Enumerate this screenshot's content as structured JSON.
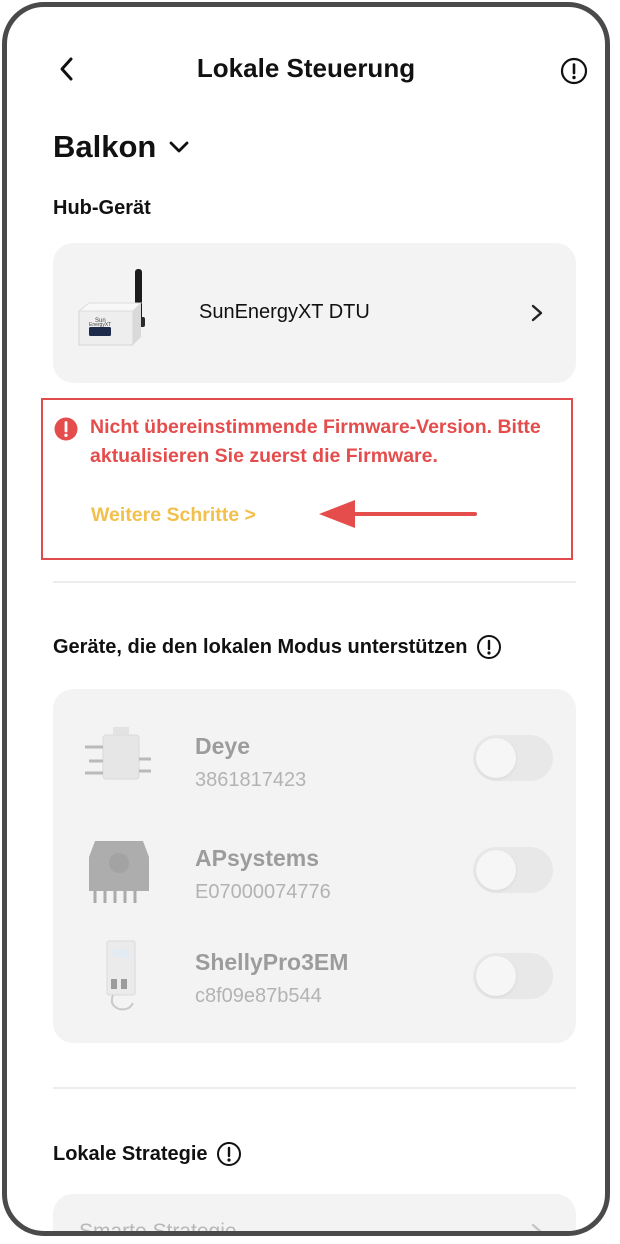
{
  "header": {
    "title": "Lokale Steuerung",
    "back_icon": "chevron-left-icon",
    "info_icon": "info-circle-icon"
  },
  "location": {
    "name": "Balkon",
    "dropdown_icon": "chevron-down-icon"
  },
  "hub": {
    "section_label": "Hub-Gerät",
    "device_name": "SunEnergyXT DTU",
    "image_text": "SunEnergyXT"
  },
  "warning": {
    "message": "Nicht übereinstimmende Firmware-Version. Bitte aktualisieren Sie zuerst die Firmware.",
    "link_label": "Weitere Schritte >",
    "color": "#e54d4d",
    "link_color": "#f2c04c"
  },
  "devices": {
    "section_label": "Geräte, die den lokalen Modus unterstützen",
    "items": [
      {
        "name": "Deye",
        "serial": "3861817423",
        "enabled": false
      },
      {
        "name": "APsystems",
        "serial": "E07000074776",
        "enabled": false
      },
      {
        "name": "ShellyPro3EM",
        "serial": "c8f09e87b544",
        "enabled": false
      }
    ]
  },
  "strategy": {
    "section_label": "Lokale Strategie",
    "selected": "Smarte Strategie"
  }
}
